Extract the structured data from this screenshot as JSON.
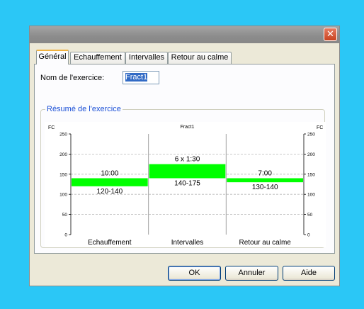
{
  "window": {
    "close_symbol": "✕"
  },
  "tabs": [
    {
      "label": "Général",
      "active": true
    },
    {
      "label": "Echauffement",
      "active": false
    },
    {
      "label": "Intervalles",
      "active": false
    },
    {
      "label": "Retour au calme",
      "active": false
    }
  ],
  "form": {
    "name_label": "Nom de l'exercice:",
    "name_value": "Fract1"
  },
  "summary": {
    "group_label": "Résumé de l'exercice"
  },
  "chart_data": {
    "type": "bar",
    "title": "Fract1",
    "ylabel_left": "FC",
    "ylabel_right": "FC",
    "ylim": [
      0,
      250
    ],
    "yticks": [
      0,
      50,
      100,
      150,
      200,
      250
    ],
    "grid": true,
    "bar_color": "#00ff00",
    "categories": [
      "Echauffement",
      "Intervalles",
      "Retour au calme"
    ],
    "ranges": [
      [
        120,
        140
      ],
      [
        140,
        175
      ],
      [
        130,
        140
      ]
    ],
    "durations": [
      "10:00",
      "6 x 1:30",
      "7:00"
    ],
    "range_labels": [
      "120-140",
      "140-175",
      "130-140"
    ]
  },
  "buttons": {
    "ok": "OK",
    "cancel": "Annuler",
    "help": "Aide"
  }
}
